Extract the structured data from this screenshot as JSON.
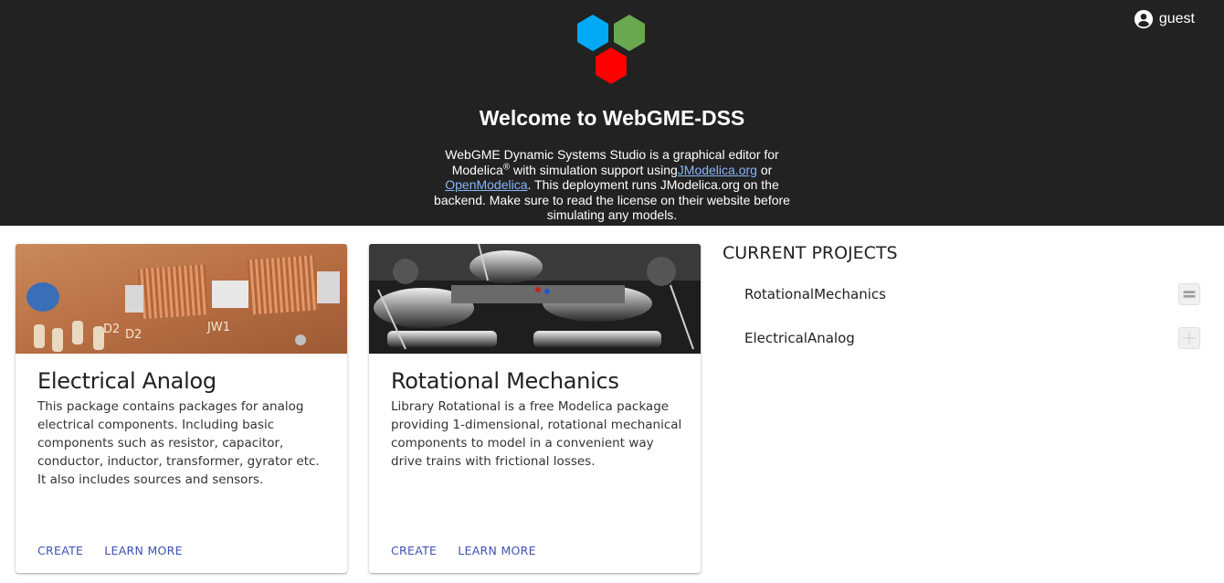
{
  "header": {
    "user_label": "guest",
    "title": "Welcome to WebGME-DSS",
    "intro": {
      "part1": "WebGME Dynamic Systems Studio is a graphical editor for Modelica",
      "reg": "®",
      "part2": " with simulation support using",
      "link1": "JModelica.org",
      "part3": " or ",
      "link2": "OpenModelica",
      "part4": ". This deployment runs JModelica.org on the backend. Make sure to read the license on their website before simulating any models."
    }
  },
  "cards": [
    {
      "title": "Electrical Analog",
      "description": "This package contains packages for analog electrical components. Including basic components such as resistor, capacitor, conductor, inductor, transformer, gyrator etc. It also includes sources and sensors.",
      "create_label": "CREATE",
      "learn_label": "LEARN MORE",
      "image": "electronic-components-photo"
    },
    {
      "title": "Rotational Mechanics",
      "description": "Library Rotational is a free Modelica package providing 1-dimensional, rotational mechanical components to model in a convenient way drive trains with frictional losses.",
      "create_label": "CREATE",
      "learn_label": "LEARN MORE",
      "image": "engine-photo"
    }
  ],
  "projects": {
    "title": "CURRENT PROJECTS",
    "items": [
      {
        "name": "RotationalMechanics"
      },
      {
        "name": "ElectricalAnalog"
      }
    ]
  },
  "colors": {
    "header_bg": "#222222",
    "accent": "#3f51b5",
    "link": "#8ab4f8",
    "logo_blue": "#03a9f4",
    "logo_green": "#6aa84f",
    "logo_red": "#ff0000"
  }
}
